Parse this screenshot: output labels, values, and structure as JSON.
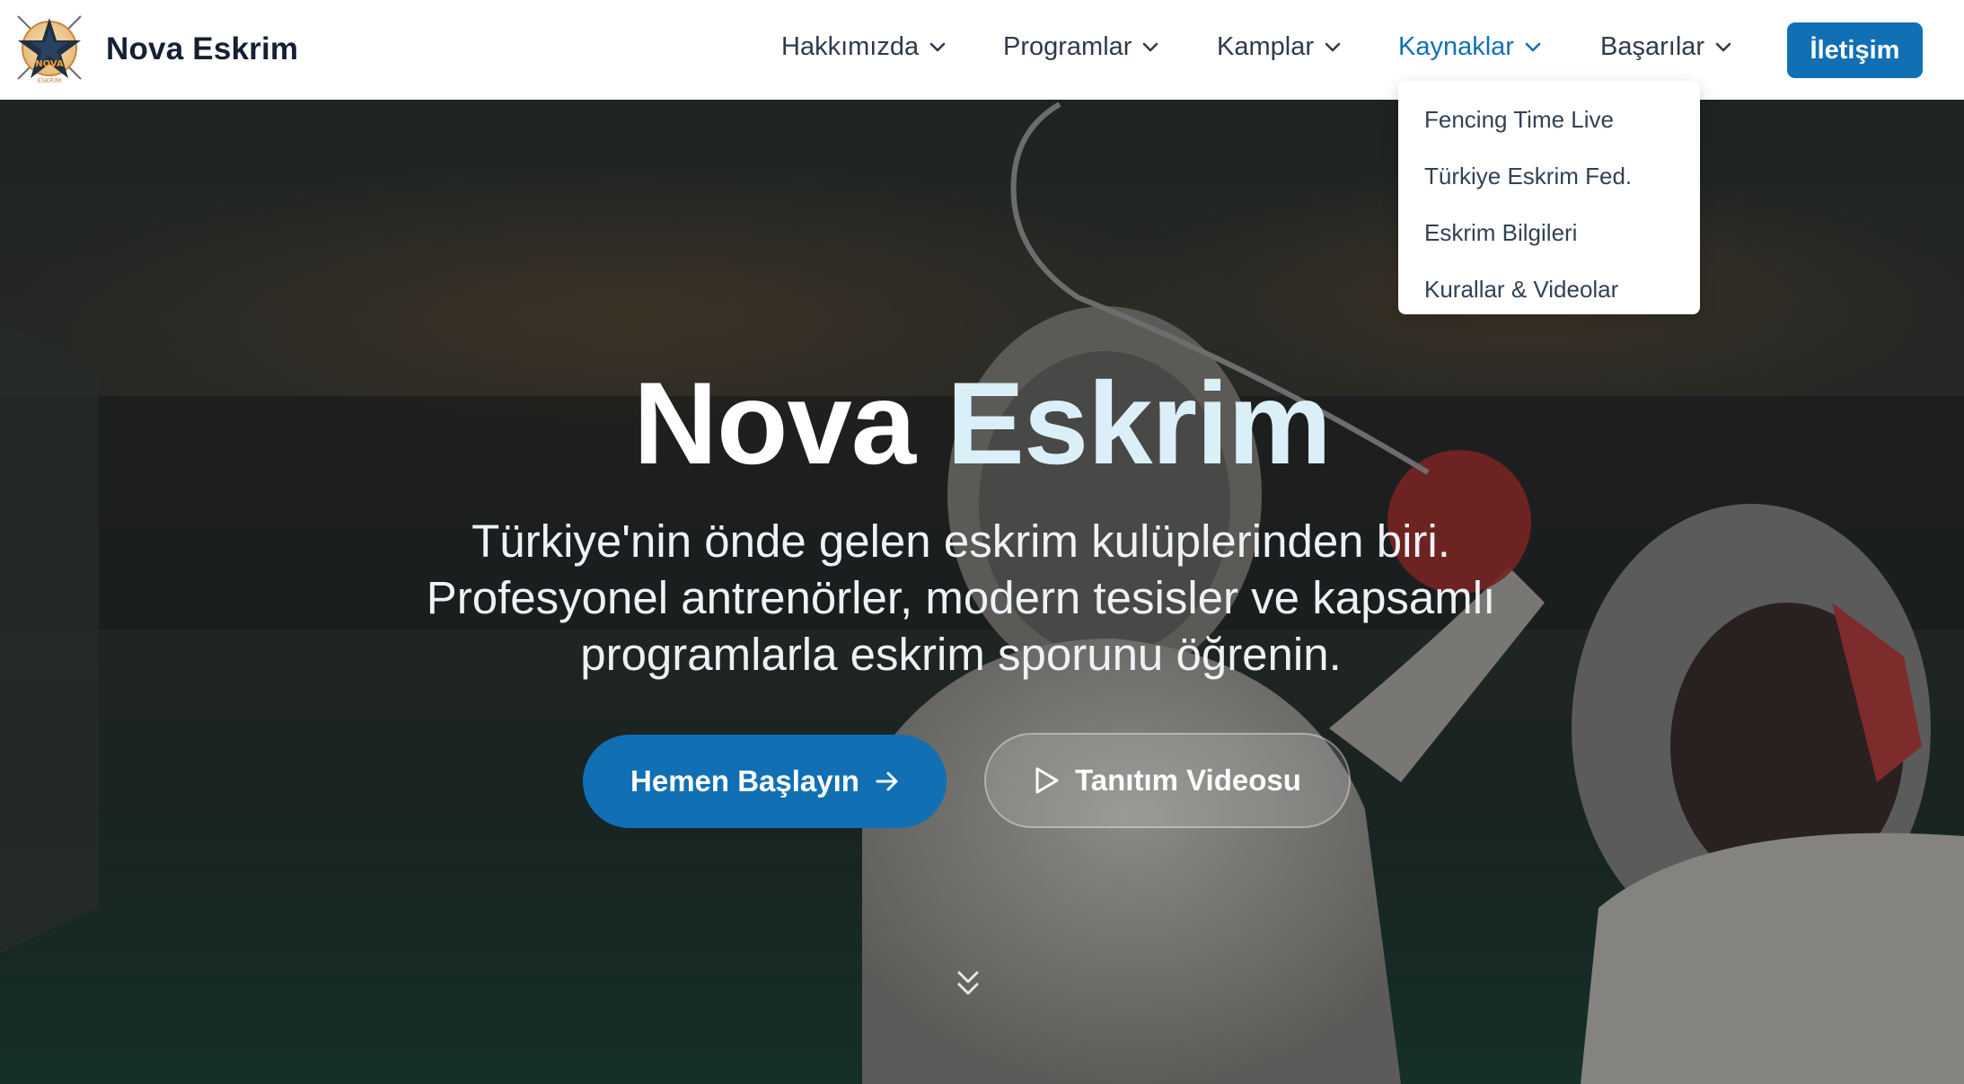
{
  "brand": {
    "name": "Nova Eskrim",
    "logo_text": "NOVA",
    "logo_subtext": "ESKRİM"
  },
  "nav": {
    "items": [
      {
        "label": "Hakkımızda"
      },
      {
        "label": "Programlar"
      },
      {
        "label": "Kamplar"
      },
      {
        "label": "Kaynaklar",
        "active": true
      },
      {
        "label": "Başarılar"
      }
    ],
    "contact_label": "İletişim"
  },
  "dropdown": {
    "items": [
      {
        "label": "Fencing Time Live"
      },
      {
        "label": "Türkiye Eskrim Fed."
      },
      {
        "label": "Eskrim Bilgileri"
      },
      {
        "label": "Kurallar & Videolar"
      }
    ]
  },
  "hero": {
    "title_part1": "Nova",
    "title_part2": "Eskrim",
    "subtitle": "Türkiye'nin önde gelen eskrim kulüplerinden biri. Profesyonel antrenörler, modern tesisler ve kapsamlı programlarla eskrim sporunu öğrenin.",
    "primary_button": "Hemen Başlayın",
    "secondary_button": "Tanıtım Videosu"
  },
  "colors": {
    "accent": "#1170b3",
    "nav_text": "#2f3a4a",
    "brand_text": "#152033",
    "title_accent": "#dbeff9"
  },
  "icons": [
    "chevron-down-icon",
    "arrow-right-icon",
    "play-icon",
    "chevrons-down-icon"
  ]
}
